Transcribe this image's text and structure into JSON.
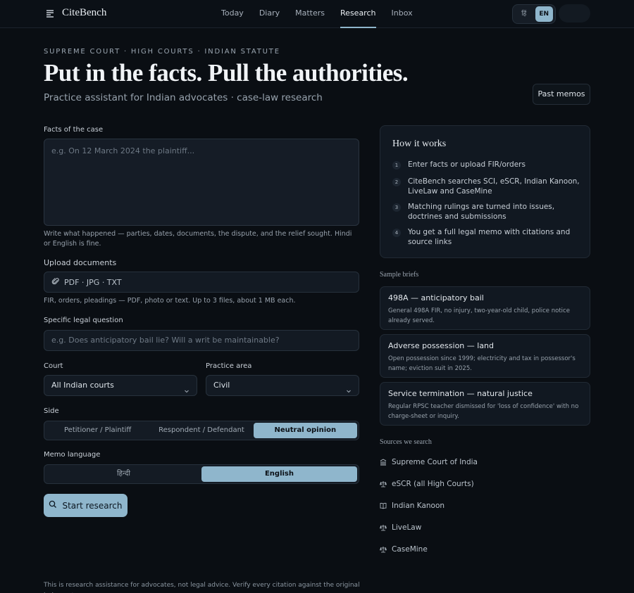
{
  "app": {
    "name": "CiteBench"
  },
  "nav": {
    "items": [
      {
        "label": "Today"
      },
      {
        "label": "Diary"
      },
      {
        "label": "Matters"
      },
      {
        "label": "Research"
      },
      {
        "label": "Inbox"
      }
    ],
    "active": "Research"
  },
  "lang_toggle": {
    "hindi": "हिं",
    "english": "EN",
    "active": "EN"
  },
  "hero": {
    "eyebrow": "SUPREME COURT · HIGH COURTS · INDIAN STATUTE",
    "title": "Put in the facts. Pull the authorities.",
    "subtitle": "Practice assistant for Indian advocates · case-law research",
    "past_memos": "Past memos"
  },
  "form": {
    "facts": {
      "label": "Facts of the case",
      "placeholder": "e.g. On 12 March 2024 the plaintiff...",
      "help": "Write what happened — parties, dates, documents, the dispute, and the relief sought. Hindi or English is fine."
    },
    "upload": {
      "label": "Upload documents",
      "text": "PDF · JPG · TXT",
      "help": "FIR, orders, pleadings — PDF, photo or text. Up to 3 files, about 1 MB each."
    },
    "question": {
      "label": "Specific legal question",
      "placeholder": "e.g. Does anticipatory bail lie? Will a writ be maintainable?"
    },
    "court": {
      "label": "Court",
      "value": "All Indian courts"
    },
    "practice_area": {
      "label": "Practice area",
      "value": "Civil"
    },
    "side": {
      "label": "Side",
      "options": [
        "Petitioner / Plaintiff",
        "Respondent / Defendant",
        "Neutral opinion"
      ],
      "selected": "Neutral opinion"
    },
    "memo_language": {
      "label": "Memo language",
      "options": [
        "हिन्दी",
        "English"
      ],
      "selected": "English"
    },
    "submit": "Start research",
    "disclaimer": "This is research assistance for advocates, not legal advice. Verify every citation against the original judgment"
  },
  "how_it_works": {
    "title": "How it works",
    "steps": [
      {
        "num": "1",
        "text": "Enter facts or upload FIR/orders"
      },
      {
        "num": "2",
        "text": "CiteBench searches SCI, eSCR, Indian Kanoon, LiveLaw and CaseMine"
      },
      {
        "num": "3",
        "text": "Matching rulings are turned into issues, doctrines and submissions"
      },
      {
        "num": "4",
        "text": "You get a full legal memo with citations and source links"
      }
    ]
  },
  "sample_briefs": {
    "heading": "Sample briefs",
    "items": [
      {
        "title": "498A — anticipatory bail",
        "desc": "General 498A FIR, no injury, two-year-old child, police notice already served."
      },
      {
        "title": "Adverse possession — land",
        "desc": "Open possession since 1999; electricity and tax in possessor's name; eviction suit in 2025."
      },
      {
        "title": "Service termination — natural justice",
        "desc": "Regular RPSC teacher dismissed for 'loss of confidence' with no charge-sheet or inquiry."
      }
    ]
  },
  "sources": {
    "heading": "Sources we search",
    "items": [
      {
        "label": "Supreme Court of India",
        "icon": "pillar-icon"
      },
      {
        "label": "eSCR (all High Courts)",
        "icon": "scales-icon"
      },
      {
        "label": "Indian Kanoon",
        "icon": "book-icon"
      },
      {
        "label": "LiveLaw",
        "icon": "scales-icon"
      },
      {
        "label": "CaseMine",
        "icon": "scales-icon"
      }
    ]
  },
  "colors": {
    "accent": "#8fb6cc",
    "background": "#0a0e13",
    "card": "#111821"
  }
}
